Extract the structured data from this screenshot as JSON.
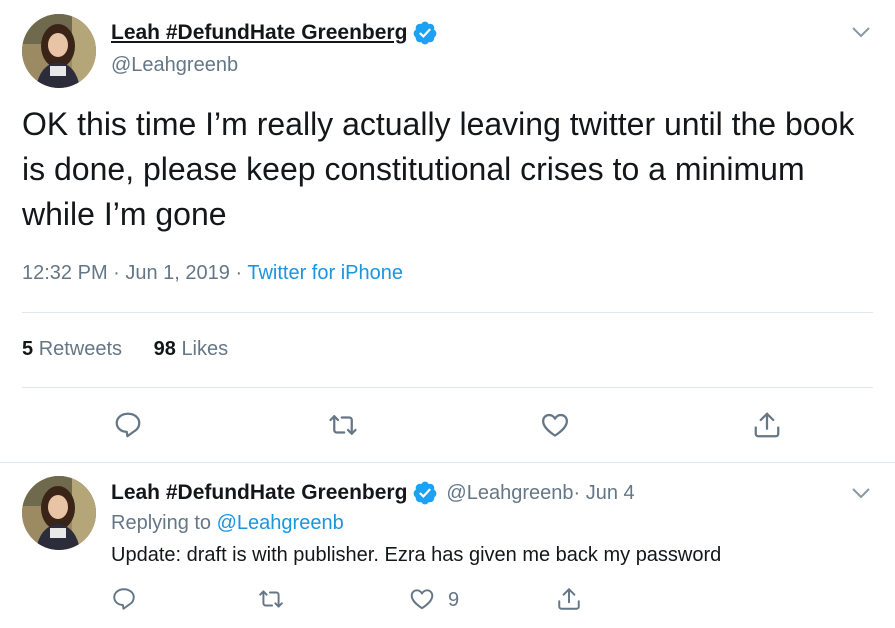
{
  "main_tweet": {
    "author_name": "Leah #DefundHate Greenberg",
    "author_handle": "@Leahgreenb",
    "text": "OK this time I’m really actually leaving twitter until the book is done, please keep constitutional crises to a minimum while I’m gone",
    "timestamp": "12:32 PM · Jun 1, 2019",
    "separator": " · ",
    "source": "Twitter for iPhone",
    "retweets_count": "5",
    "retweets_label": "Retweets",
    "likes_count": "98",
    "likes_label": "Likes"
  },
  "reply_tweet": {
    "author_name": "Leah #DefundHate Greenberg",
    "author_handle": "@Leahgreenb",
    "date": " · Jun 4",
    "replying_to_label": "Replying to ",
    "replying_to_handle": "@Leahgreenb",
    "text": "Update: draft is with publisher. Ezra has given me back my password",
    "likes_count": "9"
  },
  "colors": {
    "text": "#14171a",
    "secondary": "#657786",
    "link": "#1b95e0",
    "divider": "#e1e8ed",
    "verified": "#1da1f2"
  },
  "icons": [
    "chevron-down-icon",
    "verified-badge-icon",
    "reply-icon",
    "retweet-icon",
    "like-icon",
    "share-icon"
  ]
}
